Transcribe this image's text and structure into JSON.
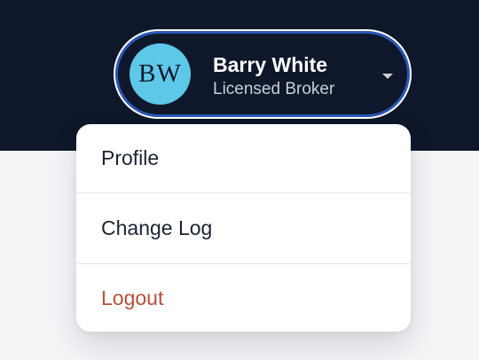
{
  "user": {
    "initials": "BW",
    "name": "Barry White",
    "role": "Licensed Broker",
    "dropdown_icon": "chevron-down-icon"
  },
  "menu": {
    "items": [
      {
        "label": "Profile"
      },
      {
        "label": "Change Log"
      },
      {
        "label": "Logout"
      }
    ]
  },
  "colors": {
    "header_bg": "#0e182a",
    "avatar_bg": "#5ec8e8",
    "pill_ring": "#2a57b8",
    "logout_text": "#b4503a",
    "page_bg": "#f4f5f7"
  }
}
